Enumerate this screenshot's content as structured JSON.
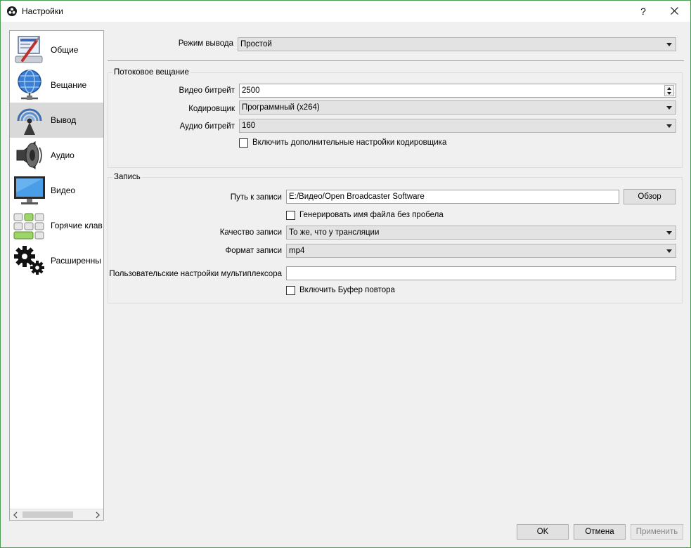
{
  "window": {
    "title": "Настройки",
    "help_symbol": "?"
  },
  "sidebar": {
    "items": [
      {
        "label": "Общие"
      },
      {
        "label": "Вещание"
      },
      {
        "label": "Вывод"
      },
      {
        "label": "Аудио"
      },
      {
        "label": "Видео"
      },
      {
        "label": "Горячие клав"
      },
      {
        "label": "Расширенны"
      }
    ],
    "selected_index": 2
  },
  "output_mode": {
    "label": "Режим вывода",
    "value": "Простой"
  },
  "streaming": {
    "group_title": "Потоковое вещание",
    "video_bitrate": {
      "label": "Видео битрейт",
      "value": "2500"
    },
    "encoder": {
      "label": "Кодировщик",
      "value": "Программный (x264)"
    },
    "audio_bitrate": {
      "label": "Аудио битрейт",
      "value": "160"
    },
    "advanced_encoder": {
      "label": "Включить дополнительные настройки кодировщика",
      "checked": false
    }
  },
  "recording": {
    "group_title": "Запись",
    "path": {
      "label": "Путь к записи",
      "value": "E:/Видео/Open Broadcaster Software",
      "browse_label": "Обзор"
    },
    "no_space_filename": {
      "label": "Генерировать имя файла без пробела",
      "checked": false
    },
    "quality": {
      "label": "Качество записи",
      "value": "То же, что у трансляции"
    },
    "format": {
      "label": "Формат записи",
      "value": "mp4"
    },
    "muxer": {
      "label": "Пользовательские настройки мультиплексора",
      "value": ""
    },
    "replay_buffer": {
      "label": "Включить Буфер повтора",
      "checked": false
    }
  },
  "footer": {
    "ok_label": "OK",
    "cancel_label": "Отмена",
    "apply_label": "Применить"
  },
  "colors": {
    "window_border": "#4a9e53",
    "selected_item": "#d9d9d9"
  }
}
